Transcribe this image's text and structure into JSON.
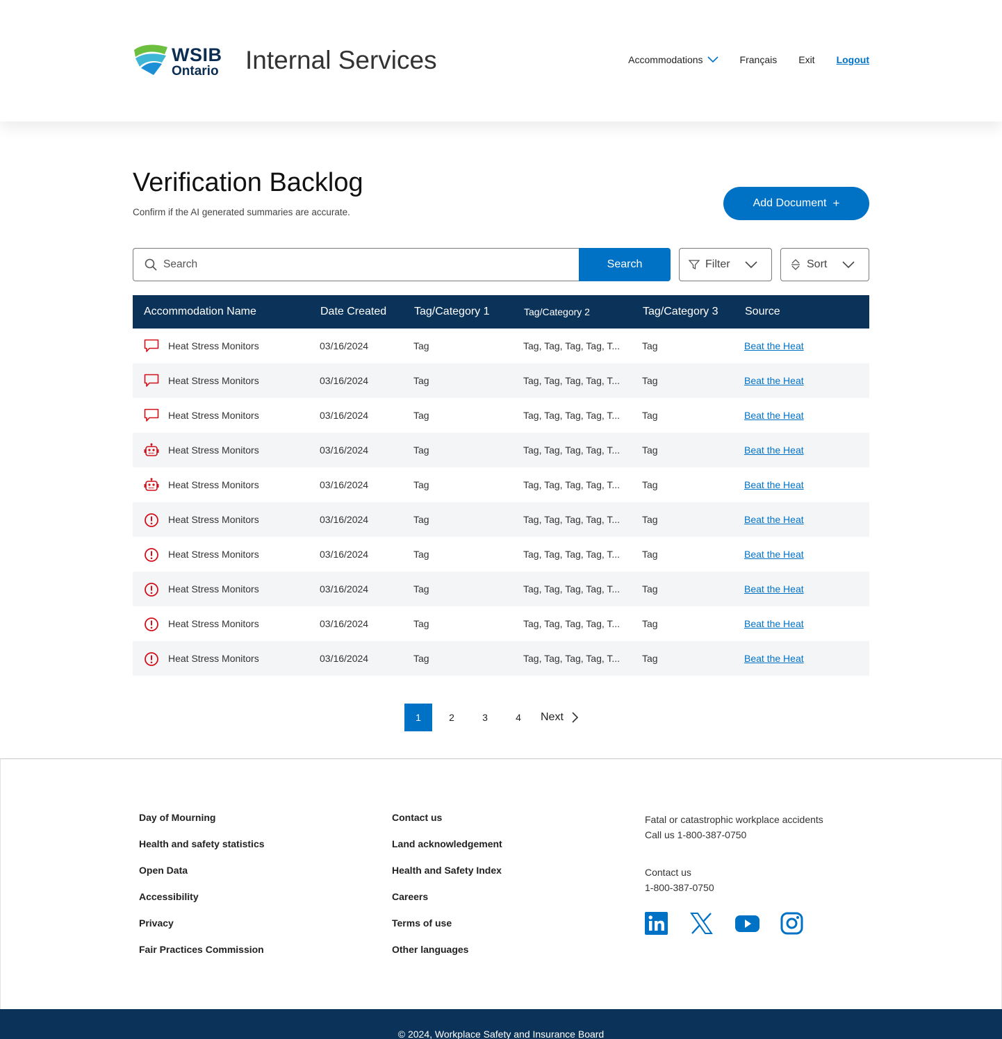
{
  "header": {
    "logo_wsib": "WSIB",
    "logo_ontario": "Ontario",
    "app_title": "Internal Services",
    "nav": {
      "accommodations": "Accommodations",
      "francais": "Français",
      "exit": "Exit",
      "logout": "Logout"
    }
  },
  "page": {
    "title": "Verification Backlog",
    "subtitle": "Confirm if the AI generated summaries are accurate.",
    "add_button": "Add Document",
    "add_button_icon": "+"
  },
  "toolbar": {
    "search_placeholder": "Search",
    "search_button": "Search",
    "filter_label": "Filter",
    "sort_label": "Sort"
  },
  "table": {
    "headers": {
      "name": "Accommodation Name",
      "date": "Date Created",
      "t1": "Tag/Category 1",
      "t2": "Tag/Category 2",
      "t3": "Tag/Category 3",
      "source": "Source"
    },
    "rows": [
      {
        "icon": "comment-icon",
        "name": "Heat Stress Monitors",
        "date": "03/16/2024",
        "t1": "Tag",
        "t2": "Tag, Tag, Tag, Tag, T...",
        "t3": "Tag",
        "source": "Beat the Heat"
      },
      {
        "icon": "comment-icon",
        "name": "Heat Stress Monitors",
        "date": "03/16/2024",
        "t1": "Tag",
        "t2": "Tag, Tag, Tag, Tag, T...",
        "t3": "Tag",
        "source": "Beat the Heat"
      },
      {
        "icon": "comment-icon",
        "name": "Heat Stress Monitors",
        "date": "03/16/2024",
        "t1": "Tag",
        "t2": "Tag, Tag, Tag, Tag, T...",
        "t3": "Tag",
        "source": "Beat the Heat"
      },
      {
        "icon": "robot-icon",
        "name": "Heat Stress Monitors",
        "date": "03/16/2024",
        "t1": "Tag",
        "t2": "Tag, Tag, Tag, Tag, T...",
        "t3": "Tag",
        "source": "Beat the Heat"
      },
      {
        "icon": "robot-icon",
        "name": "Heat Stress Monitors",
        "date": "03/16/2024",
        "t1": "Tag",
        "t2": "Tag, Tag, Tag, Tag, T...",
        "t3": "Tag",
        "source": "Beat the Heat"
      },
      {
        "icon": "alert-icon",
        "name": "Heat Stress Monitors",
        "date": "03/16/2024",
        "t1": "Tag",
        "t2": "Tag, Tag, Tag, Tag, T...",
        "t3": "Tag",
        "source": "Beat the Heat"
      },
      {
        "icon": "alert-icon",
        "name": "Heat Stress Monitors",
        "date": "03/16/2024",
        "t1": "Tag",
        "t2": "Tag, Tag, Tag, Tag, T...",
        "t3": "Tag",
        "source": "Beat the Heat"
      },
      {
        "icon": "alert-icon",
        "name": "Heat Stress Monitors",
        "date": "03/16/2024",
        "t1": "Tag",
        "t2": "Tag, Tag, Tag, Tag, T...",
        "t3": "Tag",
        "source": "Beat the Heat"
      },
      {
        "icon": "alert-icon",
        "name": "Heat Stress Monitors",
        "date": "03/16/2024",
        "t1": "Tag",
        "t2": "Tag, Tag, Tag, Tag, T...",
        "t3": "Tag",
        "source": "Beat the Heat"
      },
      {
        "icon": "alert-icon",
        "name": "Heat Stress Monitors",
        "date": "03/16/2024",
        "t1": "Tag",
        "t2": "Tag, Tag, Tag, Tag, T...",
        "t3": "Tag",
        "source": "Beat the Heat"
      }
    ]
  },
  "pagination": {
    "pages": [
      "1",
      "2",
      "3",
      "4"
    ],
    "current": "1",
    "next_label": "Next"
  },
  "footer": {
    "col1": [
      "Day of Mourning",
      "Health and safety statistics",
      "Open Data",
      "Accessibility",
      "Privacy",
      "Fair Practices Commission"
    ],
    "col2": [
      "Contact us",
      "Land acknowledgement",
      "Health and Safety Index",
      "Careers",
      "Terms of use",
      "Other languages"
    ],
    "emergency_line1": "Fatal or catastrophic workplace accidents",
    "emergency_line2": "Call us 1-800-387-0750",
    "contact_line1": "Contact us",
    "contact_line2": "1-800-387-0750",
    "social": [
      "linkedin-icon",
      "x-icon",
      "youtube-icon",
      "instagram-icon"
    ],
    "copyright": "© 2024, Workplace Safety and Insurance Board"
  },
  "colors": {
    "primary_blue": "#0072c6",
    "navy": "#0b3359",
    "alert_red": "#d0111b",
    "row_alt": "#f4f5f7"
  }
}
